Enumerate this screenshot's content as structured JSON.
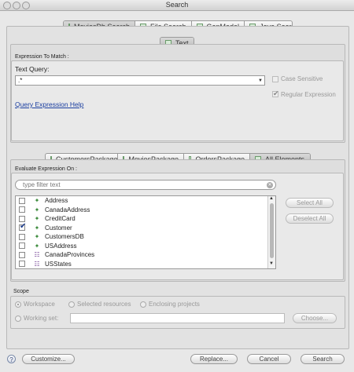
{
  "window": {
    "title": "Search"
  },
  "top_tabs": [
    {
      "label": "MoviesDb Search"
    },
    {
      "label": "File Search"
    },
    {
      "label": "GenModel"
    },
    {
      "label": "Java Search"
    }
  ],
  "text_tab": {
    "label": "Text"
  },
  "expression": {
    "group_label": "Expression To Match :",
    "query_label": "Text Query:",
    "query_value": ".*",
    "case_sensitive": "Case Sensitive",
    "regular_expression": "Regular Expression",
    "help_link": "Query Expression Help"
  },
  "package_tabs": [
    {
      "label": "CustomersPackage"
    },
    {
      "label": "MoviesPackage"
    },
    {
      "label": "OrdersPackage"
    },
    {
      "label": "All Elements"
    }
  ],
  "evaluate": {
    "group_label": "Evaluate Expression On :",
    "filter_placeholder": "type filter text",
    "items": [
      {
        "label": "Address",
        "icon": "class-icon",
        "checked": false
      },
      {
        "label": "CanadaAddress",
        "icon": "class-icon",
        "checked": false
      },
      {
        "label": "CreditCard",
        "icon": "class-icon",
        "checked": false
      },
      {
        "label": "Customer",
        "icon": "class-icon",
        "checked": true
      },
      {
        "label": "CustomersDB",
        "icon": "class-icon",
        "checked": false
      },
      {
        "label": "USAddress",
        "icon": "class-icon",
        "checked": false
      },
      {
        "label": "CanadaProvinces",
        "icon": "enum-icon",
        "checked": false
      },
      {
        "label": "USStates",
        "icon": "enum-icon",
        "checked": false
      }
    ],
    "select_all": "Select All",
    "deselect_all": "Deselect All"
  },
  "scope": {
    "label": "Scope",
    "workspace": "Workspace",
    "selected_resources": "Selected resources",
    "enclosing_projects": "Enclosing projects",
    "working_set": "Working set:",
    "choose": "Choose..."
  },
  "footer": {
    "help": "?",
    "customize": "Customize...",
    "replace": "Replace...",
    "cancel": "Cancel",
    "search": "Search"
  }
}
